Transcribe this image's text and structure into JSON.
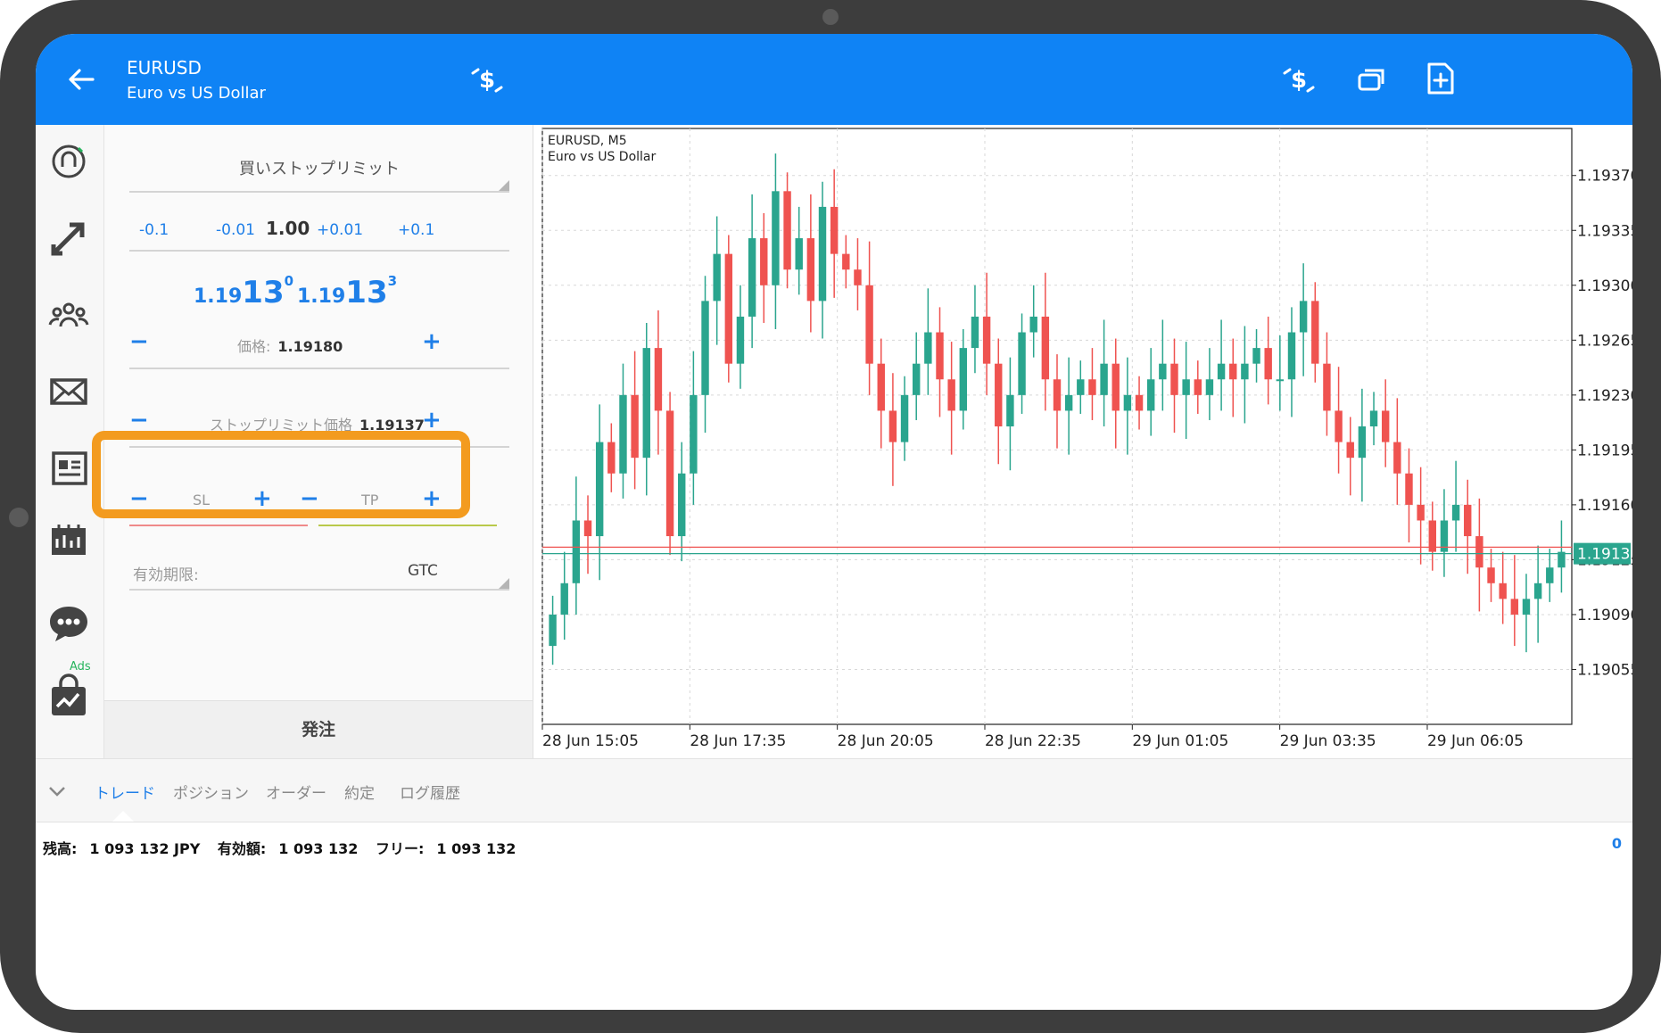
{
  "header": {
    "symbol": "EURUSD",
    "description": "Euro vs US Dollar"
  },
  "sidebar": {
    "items": [
      "logo-icon",
      "trade-icon",
      "community-icon",
      "mail-icon",
      "news-icon",
      "calendar-icon",
      "chat-icon",
      "market-icon"
    ],
    "ads_label": "Ads"
  },
  "order": {
    "type": "買いストップリミット",
    "volume_steps": [
      "-0.1",
      "-0.01",
      "+0.01",
      "+0.1"
    ],
    "volume": "1.00",
    "sell_price": {
      "small": "1.19",
      "big": "13",
      "sup": "0"
    },
    "buy_price": {
      "small": "1.19",
      "big": "13",
      "sup": "3"
    },
    "price_label": "価格:",
    "price_value": "1.19180",
    "stoplimit_label": "ストップリミット価格",
    "stoplimit_value": "1.19137",
    "sl_label": "SL",
    "tp_label": "TP",
    "expiry_label": "有効期限:",
    "expiry_value": "GTC",
    "submit_label": "発注",
    "minus": "−",
    "plus": "+"
  },
  "chart_data": {
    "type": "candlestick",
    "title": "EURUSD, M5",
    "subtitle": "Euro vs US Dollar",
    "y_ticks": [
      "1.19370",
      "1.19335",
      "1.19300",
      "1.19265",
      "1.19230",
      "1.19195",
      "1.19160",
      "1.19125",
      "1.19090",
      "1.19055"
    ],
    "x_ticks": [
      "28 Jun 15:05",
      "28 Jun 17:35",
      "28 Jun 20:05",
      "28 Jun 22:35",
      "29 Jun 01:05",
      "29 Jun 03:35",
      "29 Jun 06:05"
    ],
    "ylim": [
      1.1902,
      1.194
    ],
    "current_bid": "1.19130",
    "bid_level": 1.1913,
    "ask_level": 1.19133,
    "closes": [
      1.1909,
      1.1911,
      1.1915,
      1.1914,
      1.192,
      1.1918,
      1.1923,
      1.1919,
      1.1926,
      1.1922,
      1.1914,
      1.1918,
      1.1923,
      1.1929,
      1.1932,
      1.1925,
      1.1928,
      1.1933,
      1.193,
      1.1936,
      1.1931,
      1.1933,
      1.1929,
      1.1935,
      1.1932,
      1.1931,
      1.193,
      1.1925,
      1.1922,
      1.192,
      1.1923,
      1.1925,
      1.1927,
      1.1924,
      1.1922,
      1.1926,
      1.1928,
      1.1925,
      1.1921,
      1.1923,
      1.1927,
      1.1928,
      1.1924,
      1.1922,
      1.1923,
      1.1924,
      1.1923,
      1.1925,
      1.1922,
      1.1923,
      1.1922,
      1.1924,
      1.1925,
      1.1923,
      1.1924,
      1.1923,
      1.1924,
      1.1925,
      1.1924,
      1.1925,
      1.1926,
      1.1924,
      1.1924,
      1.1927,
      1.1929,
      1.1925,
      1.1922,
      1.192,
      1.1919,
      1.1921,
      1.1922,
      1.192,
      1.1918,
      1.1916,
      1.1915,
      1.1913,
      1.1915,
      1.1916,
      1.1914,
      1.1912,
      1.1911,
      1.191,
      1.1909,
      1.191,
      1.1911,
      1.1912,
      1.1913
    ]
  },
  "tabs": [
    "トレード",
    "ポジション",
    "オーダー",
    "約定",
    "ログ履歴"
  ],
  "account": {
    "balance_label": "残高:",
    "balance_value": "1 093 132 JPY",
    "equity_label": "有効額:",
    "equity_value": "1 093 132",
    "free_label": "フリー:",
    "free_value": "1 093 132",
    "right_value": "0"
  },
  "colors": {
    "brand": "#0f83f5",
    "bull": "#2aa58e",
    "bear": "#ef5350",
    "highlight": "#f39b1f"
  }
}
